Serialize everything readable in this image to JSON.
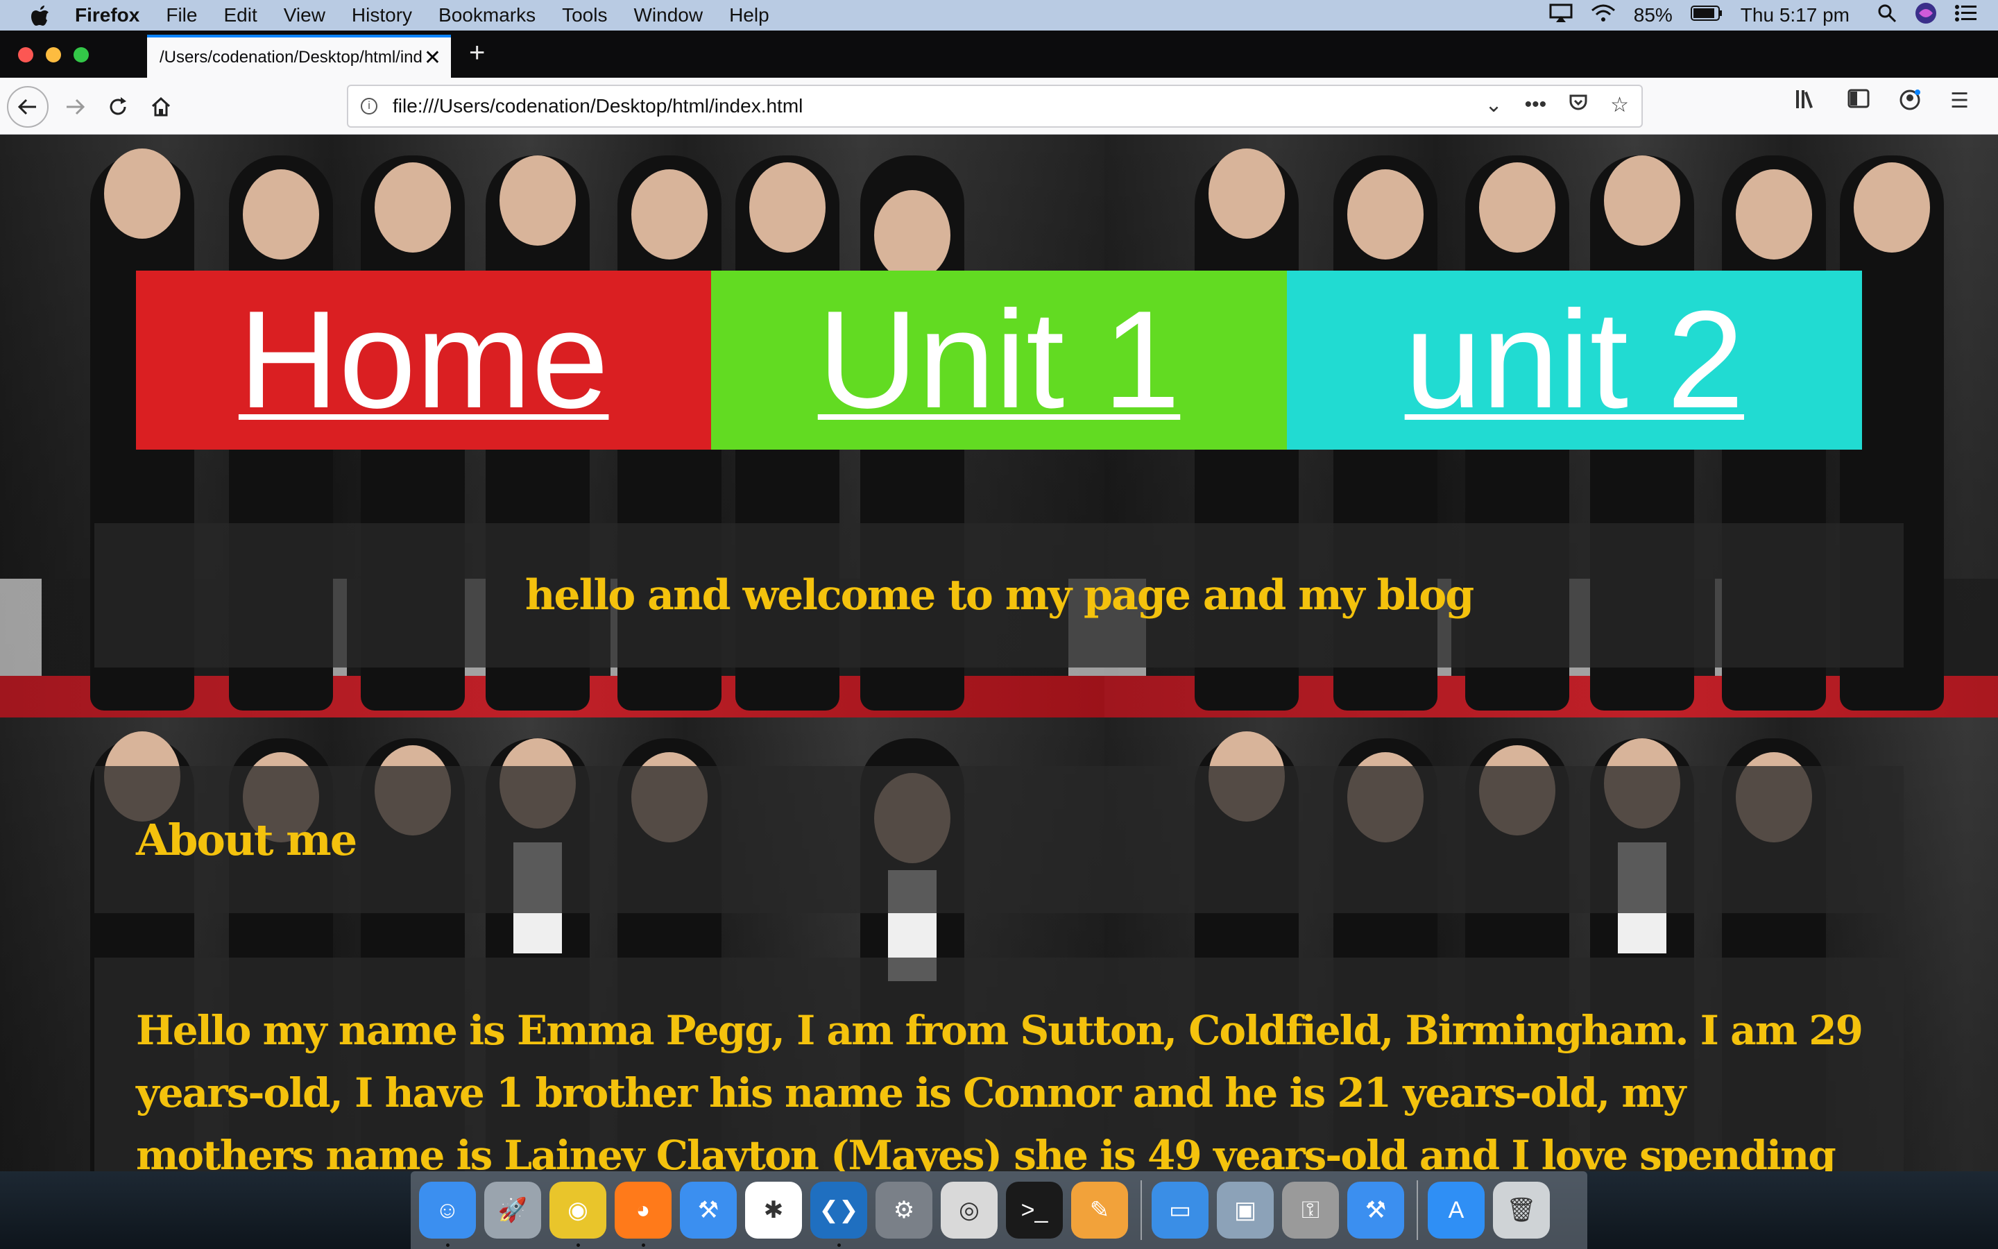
{
  "menubar": {
    "app_name": "Firefox",
    "items": [
      "File",
      "Edit",
      "View",
      "History",
      "Bookmarks",
      "Tools",
      "Window",
      "Help"
    ],
    "battery": "85%",
    "clock": "Thu 5:17 pm"
  },
  "browser": {
    "tab_title": "/Users/codenation/Desktop/html/index.html",
    "new_tab": "+",
    "url": "file:///Users/codenation/Desktop/html/index.html"
  },
  "page": {
    "nav": [
      {
        "label": "Home",
        "color": "#da1f22"
      },
      {
        "label": "Unit 1",
        "color": "#62db22"
      },
      {
        "label": "unit 2",
        "color": "#21dbd2"
      }
    ],
    "welcome": "hello and welcome to my page and my blog",
    "about_heading": "About me",
    "bio": "Hello my name is Emma Pegg, I am from Sutton, Coldfield, Birmingham. I am 29 years-old, I have 1 brother his name is Connor and he is 21 years-old, my mothers name is Lainey Clayton (Mayes) she is 49 years-old and I love spending time with"
  },
  "dock": {
    "apps": [
      {
        "name": "finder-icon",
        "color": "#3b8ff0",
        "glyph": "☺"
      },
      {
        "name": "launchpad-icon",
        "color": "#9aa4ae",
        "glyph": "🚀"
      },
      {
        "name": "chrome-icon",
        "color": "#e9c52b",
        "glyph": "◉"
      },
      {
        "name": "firefox-icon",
        "color": "#ff7a1a",
        "glyph": "◕"
      },
      {
        "name": "xcode-icon",
        "color": "#3b8ff0",
        "glyph": "⚒"
      },
      {
        "name": "slack-icon",
        "color": "#ffffff",
        "glyph": "✱"
      },
      {
        "name": "vscode-icon",
        "color": "#1f6fc0",
        "glyph": "❮❯"
      },
      {
        "name": "system-preferences-icon",
        "color": "#7a8088",
        "glyph": "⚙"
      },
      {
        "name": "screenshot-icon",
        "color": "#d9d9d9",
        "glyph": "◎"
      },
      {
        "name": "terminal-icon",
        "color": "#1a1a1a",
        "glyph": ">_"
      },
      {
        "name": "pages-icon",
        "color": "#f2a23a",
        "glyph": "✎"
      },
      {
        "name": "keynote-icon",
        "color": "#3a8ee6",
        "glyph": "▭"
      },
      {
        "name": "preview-icon",
        "color": "#8ca2b8",
        "glyph": "▣"
      },
      {
        "name": "keychain-icon",
        "color": "#9a9a9a",
        "glyph": "⚿"
      },
      {
        "name": "xcode-doc-icon",
        "color": "#3b8ff0",
        "glyph": "⚒"
      },
      {
        "name": "app-store-icon",
        "color": "#2f8ff5",
        "glyph": "A"
      },
      {
        "name": "trash-icon",
        "color": "#cfd3d6",
        "glyph": "🗑"
      }
    ]
  }
}
